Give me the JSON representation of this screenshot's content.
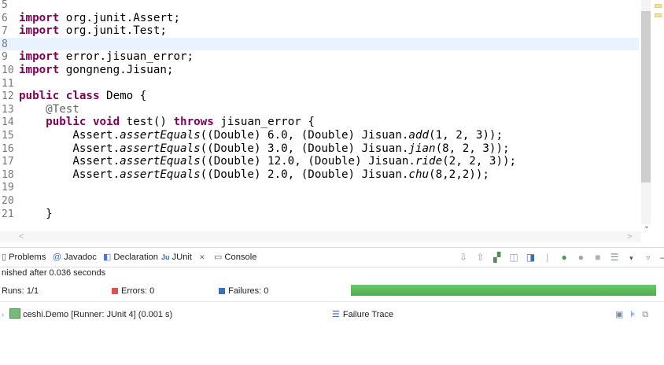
{
  "editor": {
    "lines": [
      {
        "num": "5",
        "parts": []
      },
      {
        "num": "6",
        "parts": [
          {
            "t": "import",
            "k": "kw"
          },
          {
            "t": " org.junit.Assert;"
          }
        ]
      },
      {
        "num": "7",
        "parts": [
          {
            "t": "import",
            "k": "kw"
          },
          {
            "t": " org.junit.Test;"
          }
        ]
      },
      {
        "num": "8",
        "parts": [],
        "current": true
      },
      {
        "num": "9",
        "parts": [
          {
            "t": "import",
            "k": "kw"
          },
          {
            "t": " error.jisuan_error;"
          }
        ]
      },
      {
        "num": "10",
        "parts": [
          {
            "t": "import",
            "k": "kw"
          },
          {
            "t": " gongneng.Jisuan;"
          }
        ]
      },
      {
        "num": "11",
        "parts": []
      },
      {
        "num": "12",
        "parts": [
          {
            "t": "public",
            "k": "kw"
          },
          {
            "t": " "
          },
          {
            "t": "class",
            "k": "kw"
          },
          {
            "t": " Demo {"
          }
        ]
      },
      {
        "num": "13",
        "parts": [
          {
            "t": "    "
          },
          {
            "t": "@Test",
            "k": "ann"
          }
        ]
      },
      {
        "num": "14",
        "parts": [
          {
            "t": "    "
          },
          {
            "t": "public",
            "k": "kw"
          },
          {
            "t": " "
          },
          {
            "t": "void",
            "k": "kw"
          },
          {
            "t": " test() "
          },
          {
            "t": "throws",
            "k": "kw"
          },
          {
            "t": " jisuan_error {"
          }
        ]
      },
      {
        "num": "15",
        "parts": [
          {
            "t": "        Assert."
          },
          {
            "t": "assertEquals",
            "k": "it"
          },
          {
            "t": "((Double) 6.0, (Double) Jisuan."
          },
          {
            "t": "add",
            "k": "it"
          },
          {
            "t": "(1, 2, 3));"
          }
        ]
      },
      {
        "num": "16",
        "parts": [
          {
            "t": "        Assert."
          },
          {
            "t": "assertEquals",
            "k": "it"
          },
          {
            "t": "((Double) 3.0, (Double) Jisuan."
          },
          {
            "t": "jian",
            "k": "it"
          },
          {
            "t": "(8, 2, 3));"
          }
        ]
      },
      {
        "num": "17",
        "parts": [
          {
            "t": "        Assert."
          },
          {
            "t": "assertEquals",
            "k": "it"
          },
          {
            "t": "((Double) 12.0, (Double) Jisuan."
          },
          {
            "t": "ride",
            "k": "it"
          },
          {
            "t": "(2, 2, 3));"
          }
        ]
      },
      {
        "num": "18",
        "parts": [
          {
            "t": "        Assert."
          },
          {
            "t": "assertEquals",
            "k": "it"
          },
          {
            "t": "((Double) 2.0, (Double) Jisuan."
          },
          {
            "t": "chu",
            "k": "it"
          },
          {
            "t": "(8,2,2));"
          }
        ]
      },
      {
        "num": "19",
        "parts": []
      },
      {
        "num": "20",
        "parts": []
      },
      {
        "num": "21",
        "parts": [
          {
            "t": "    }"
          }
        ]
      }
    ]
  },
  "views": {
    "tabs": [
      {
        "label": "Problems",
        "icon": "▯",
        "icon_name": "problems-icon"
      },
      {
        "label": "Javadoc",
        "icon": "@",
        "icon_name": "javadoc-icon"
      },
      {
        "label": "Declaration",
        "icon": "◧",
        "icon_name": "declaration-icon"
      },
      {
        "label": "JUnit",
        "icon": "Ju",
        "icon_name": "junit-icon",
        "close": "✕"
      },
      {
        "label": "Console",
        "icon": "▭",
        "icon_name": "console-icon"
      }
    ]
  },
  "junit": {
    "status": "nished after 0.036 seconds",
    "runs_label": "Runs:",
    "runs_value": "1/1",
    "errors_label": "Errors:",
    "errors_value": "0",
    "failures_label": "Failures:",
    "failures_value": "0",
    "progress": 1.0,
    "progress_color": "#4cae4c",
    "tree_item": "ceshi.Demo [Runner: JUnit 4] (0.001 s)",
    "failure_trace_label": "Failure Trace"
  },
  "colors": {
    "keyword": "#7f0055",
    "annotation": "#646464",
    "current_line": "#e8f2fe"
  }
}
